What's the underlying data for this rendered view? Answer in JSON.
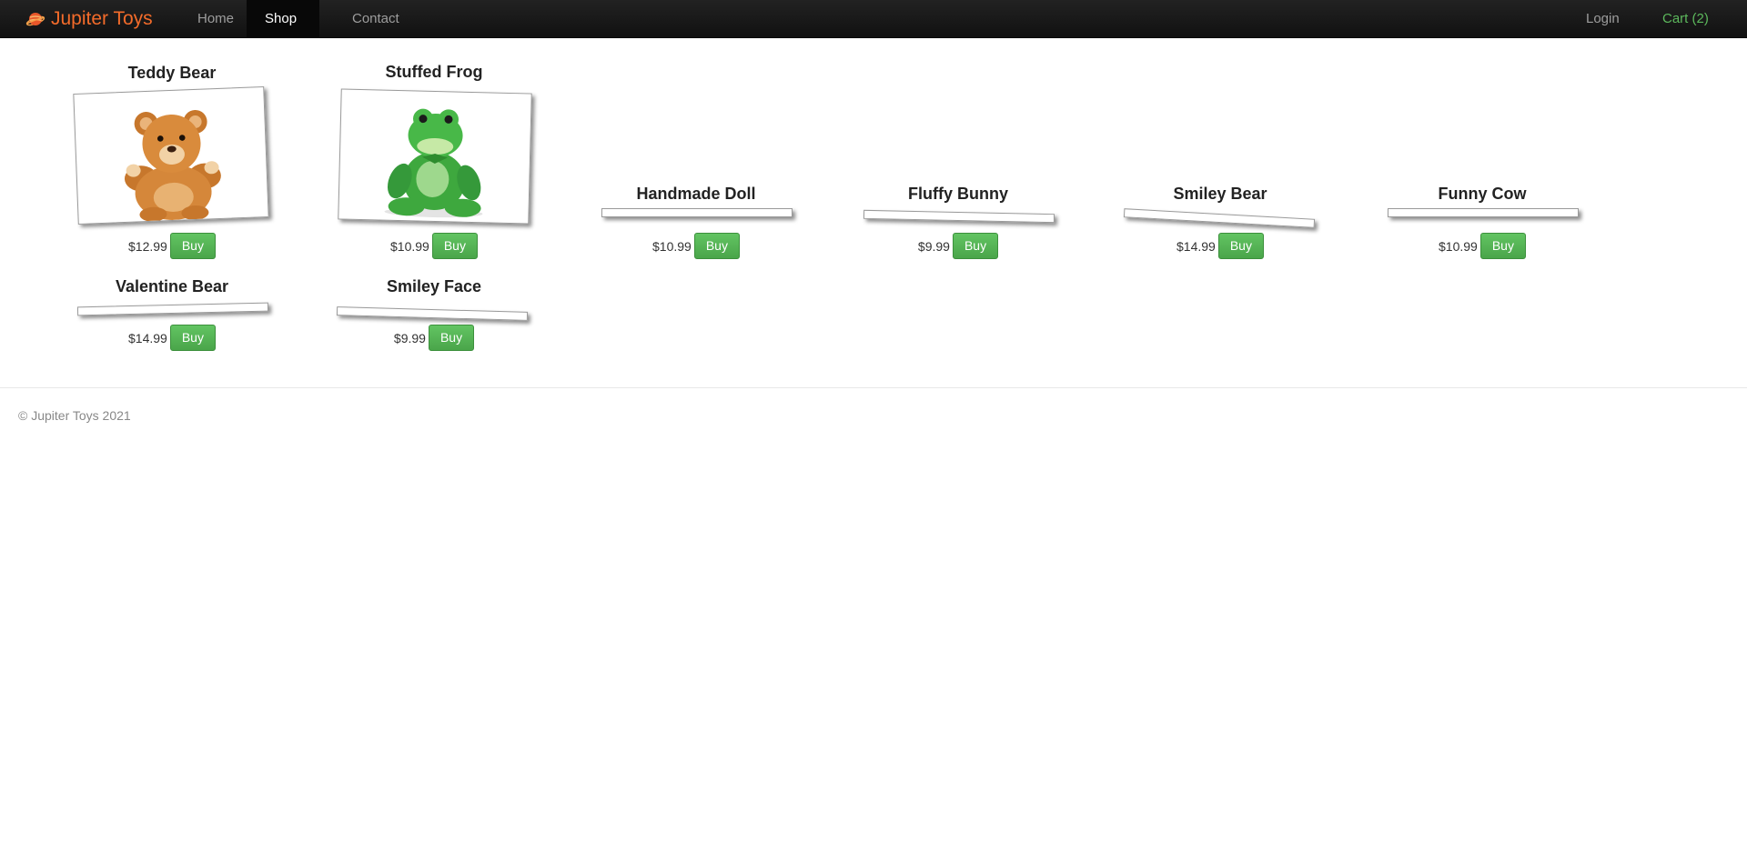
{
  "brand": {
    "name": "Jupiter Toys",
    "color": "#f36b2a"
  },
  "nav": {
    "home": "Home",
    "shop": "Shop",
    "contact": "Contact",
    "login": "Login",
    "cart": "Cart (2)"
  },
  "products": [
    {
      "title": "Teddy Bear",
      "price": "$12.99",
      "buy": "Buy",
      "image": "teddy-bear-image"
    },
    {
      "title": "Stuffed Frog",
      "price": "$10.99",
      "buy": "Buy",
      "image": "stuffed-frog-image"
    },
    {
      "title": "Handmade Doll",
      "price": "$10.99",
      "buy": "Buy",
      "image": ""
    },
    {
      "title": "Fluffy Bunny",
      "price": "$9.99",
      "buy": "Buy",
      "image": ""
    },
    {
      "title": "Smiley Bear",
      "price": "$14.99",
      "buy": "Buy",
      "image": ""
    },
    {
      "title": "Funny Cow",
      "price": "$10.99",
      "buy": "Buy",
      "image": ""
    },
    {
      "title": "Valentine Bear",
      "price": "$14.99",
      "buy": "Buy",
      "image": ""
    },
    {
      "title": "Smiley Face",
      "price": "$9.99",
      "buy": "Buy",
      "image": ""
    }
  ],
  "footer": {
    "copyright": "© Jupiter Toys 2021"
  },
  "colors": {
    "buy_button": "#5cb85c",
    "cart_link": "#5cb85c",
    "navbar": "#1b1b1b"
  }
}
